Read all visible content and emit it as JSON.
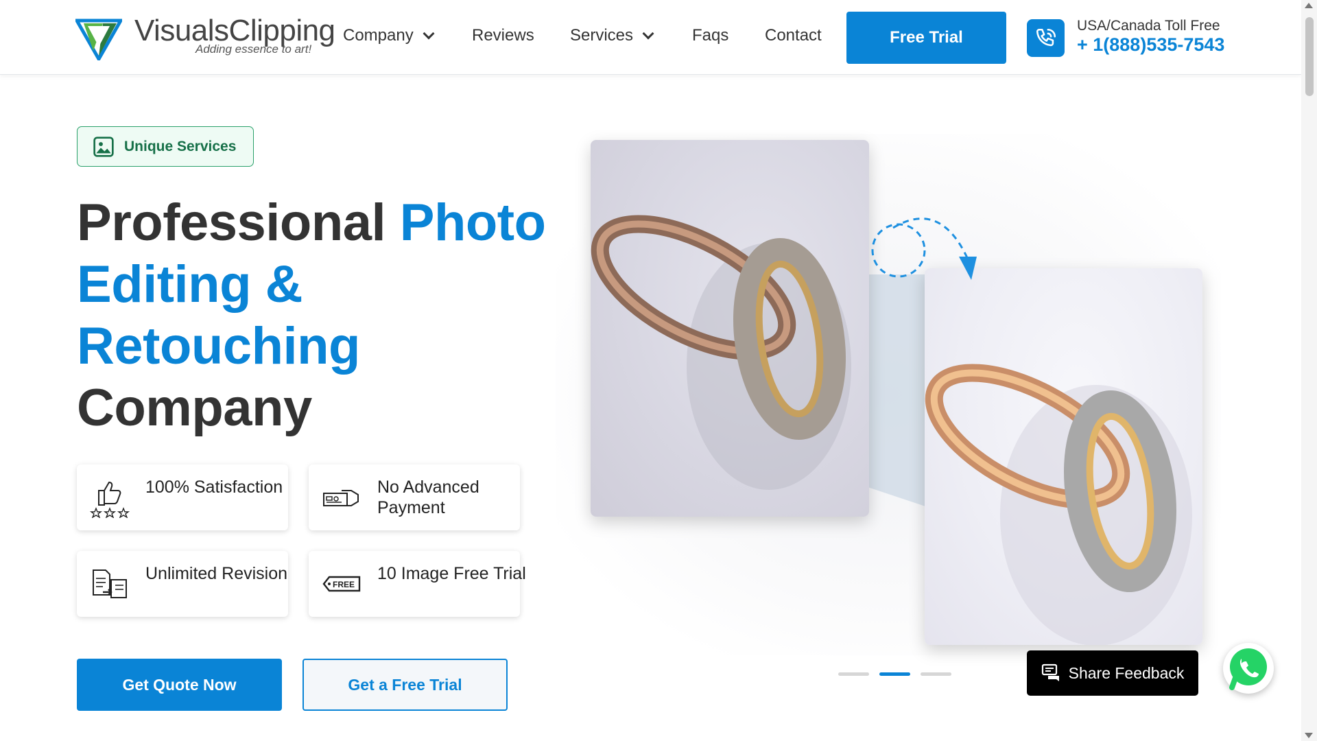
{
  "header": {
    "logo": {
      "name": "VisualsClipping",
      "tagline": "Adding essence to art!"
    },
    "nav": [
      {
        "label": "Company",
        "has_dropdown": true
      },
      {
        "label": "Reviews",
        "has_dropdown": false
      },
      {
        "label": "Services",
        "has_dropdown": true
      },
      {
        "label": "Faqs",
        "has_dropdown": false
      },
      {
        "label": "Contact",
        "has_dropdown": false
      }
    ],
    "trial_button": "Free Trial",
    "phone": {
      "label": "USA/Canada Toll Free",
      "number": "+ 1(888)535-7543",
      "icon": "phone-icon"
    }
  },
  "hero": {
    "badge": {
      "label": "Unique Services",
      "icon": "image-icon"
    },
    "headline": {
      "part1": "Professional ",
      "part2": "Photo",
      "part3": "Editing &",
      "part4": "Retouching",
      "part5": "Company"
    },
    "features": [
      {
        "label": "100% Satisfaction",
        "icon": "thumbs-up-stars-icon"
      },
      {
        "label": "No Advanced Payment",
        "icon": "payment-card-icon"
      },
      {
        "label": "Unlimited Revision",
        "icon": "document-revision-icon"
      },
      {
        "label": "10 Image Free Trial",
        "icon": "free-tag-icon"
      }
    ],
    "buttons": {
      "quote": "Get Quote Now",
      "free_trial": "Get a Free Trial"
    },
    "slider": {
      "count": 3,
      "active": 2
    }
  },
  "widgets": {
    "feedback": "Share Feedback",
    "whatsapp_icon": "whatsapp-icon"
  },
  "colors": {
    "accent": "#0a84d6",
    "badge_green": "#167048",
    "text_dark": "#333333"
  }
}
